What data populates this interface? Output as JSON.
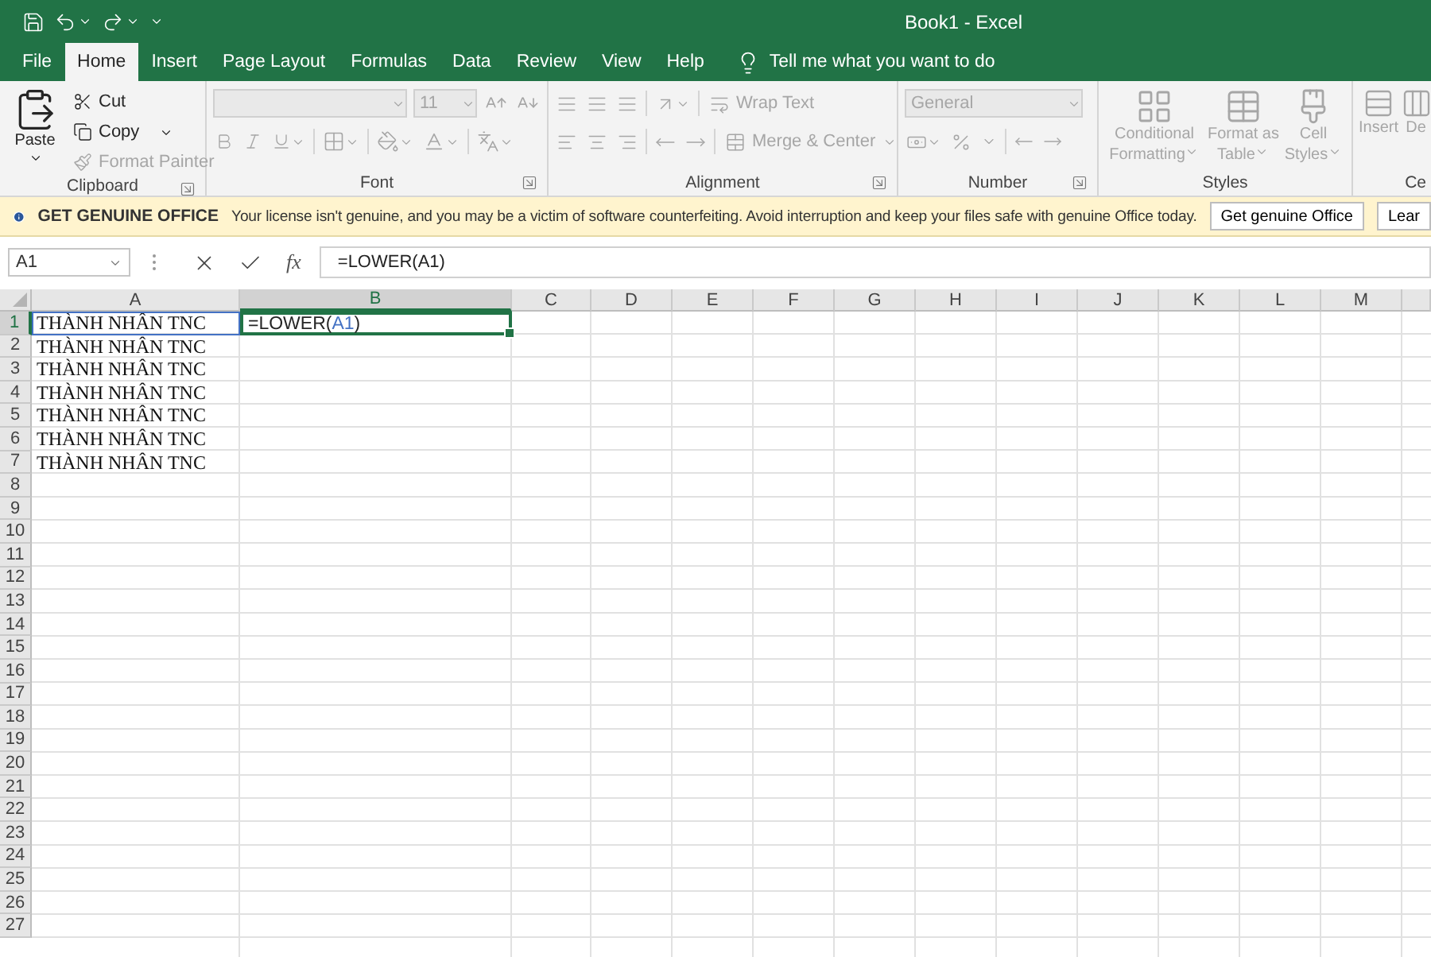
{
  "title_bar": {
    "title": "Book1  -  Excel"
  },
  "tabs": [
    {
      "label": "File",
      "selected": false
    },
    {
      "label": "Home",
      "selected": true
    },
    {
      "label": "Insert",
      "selected": false
    },
    {
      "label": "Page Layout",
      "selected": false
    },
    {
      "label": "Formulas",
      "selected": false
    },
    {
      "label": "Data",
      "selected": false
    },
    {
      "label": "Review",
      "selected": false
    },
    {
      "label": "View",
      "selected": false
    },
    {
      "label": "Help",
      "selected": false
    }
  ],
  "tell_me": {
    "placeholder": "Tell me what you want to do"
  },
  "ribbon": {
    "clipboard": {
      "label": "Clipboard",
      "paste": {
        "label": "Paste",
        "disabled": false
      },
      "cut": {
        "label": "Cut",
        "disabled": false
      },
      "copy": {
        "label": "Copy",
        "disabled": false
      },
      "format_painter": {
        "label": "Format Painter",
        "disabled": true
      }
    },
    "font": {
      "label": "Font",
      "disabled": true,
      "font_size": "11"
    },
    "alignment": {
      "label": "Alignment",
      "disabled": true,
      "wrap_text": "Wrap Text",
      "merge_center": "Merge & Center"
    },
    "number": {
      "label": "Number",
      "disabled": true,
      "format": "General"
    },
    "styles": {
      "label": "Styles",
      "disabled": true,
      "buttons": [
        "Conditional Formatting",
        "Format as Table",
        "Cell Styles"
      ]
    },
    "cells": {
      "label": "Ce",
      "disabled": true,
      "buttons": [
        "Insert",
        "De"
      ]
    }
  },
  "message_bar": {
    "title": "GET GENUINE OFFICE",
    "message": "Your license isn't genuine, and you may be a victim of software counterfeiting. Avoid interruption and keep your files safe with genuine Office today.",
    "buttons": [
      "Get genuine Office",
      "Lear"
    ]
  },
  "formula_bar": {
    "name_box": "A1",
    "function_label": "fx",
    "formula": "=LOWER(A1)"
  },
  "sheet": {
    "columns": [
      {
        "label": "A",
        "selected": false
      },
      {
        "label": "B",
        "selected": true
      },
      {
        "label": "C",
        "selected": false
      },
      {
        "label": "D",
        "selected": false
      },
      {
        "label": "E",
        "selected": false
      },
      {
        "label": "F",
        "selected": false
      },
      {
        "label": "G",
        "selected": false
      },
      {
        "label": "H",
        "selected": false
      },
      {
        "label": "I",
        "selected": false
      },
      {
        "label": "J",
        "selected": false
      },
      {
        "label": "K",
        "selected": false
      },
      {
        "label": "L",
        "selected": false
      },
      {
        "label": "M",
        "selected": false
      }
    ],
    "rows": [
      {
        "label": "1",
        "selected": true,
        "cells": [
          {
            "text": "THÀNH NHÂN TNC",
            "referenced": true
          },
          {
            "editing": true,
            "formula_prefix": "=LOWER(",
            "formula_reference": "A1",
            "formula_suffix": ")"
          }
        ]
      },
      {
        "label": "2",
        "selected": false,
        "cells": [
          {
            "text": "THÀNH NHÂN TNC",
            "referenced": false
          }
        ]
      },
      {
        "label": "3",
        "selected": false,
        "cells": [
          {
            "text": "THÀNH NHÂN TNC",
            "referenced": false
          }
        ]
      },
      {
        "label": "4",
        "selected": false,
        "cells": [
          {
            "text": "THÀNH NHÂN TNC",
            "referenced": false
          }
        ]
      },
      {
        "label": "5",
        "selected": false,
        "cells": [
          {
            "text": "THÀNH NHÂN TNC",
            "referenced": false
          }
        ]
      },
      {
        "label": "6",
        "selected": false,
        "cells": [
          {
            "text": "THÀNH NHÂN TNC",
            "referenced": false
          }
        ]
      },
      {
        "label": "7",
        "selected": false,
        "cells": [
          {
            "text": "THÀNH NHÂN TNC",
            "referenced": false
          }
        ]
      },
      {
        "label": "8",
        "selected": false
      },
      {
        "label": "9",
        "selected": false
      },
      {
        "label": "10",
        "selected": false
      },
      {
        "label": "11",
        "selected": false
      },
      {
        "label": "12",
        "selected": false
      },
      {
        "label": "13",
        "selected": false
      },
      {
        "label": "14",
        "selected": false
      },
      {
        "label": "15",
        "selected": false
      },
      {
        "label": "16",
        "selected": false
      },
      {
        "label": "17",
        "selected": false
      },
      {
        "label": "18",
        "selected": false
      },
      {
        "label": "19",
        "selected": false
      },
      {
        "label": "20",
        "selected": false
      },
      {
        "label": "21",
        "selected": false
      },
      {
        "label": "22",
        "selected": false
      },
      {
        "label": "23",
        "selected": false
      },
      {
        "label": "24",
        "selected": false
      },
      {
        "label": "25",
        "selected": false
      },
      {
        "label": "26",
        "selected": false
      },
      {
        "label": "27",
        "selected": false
      }
    ]
  }
}
